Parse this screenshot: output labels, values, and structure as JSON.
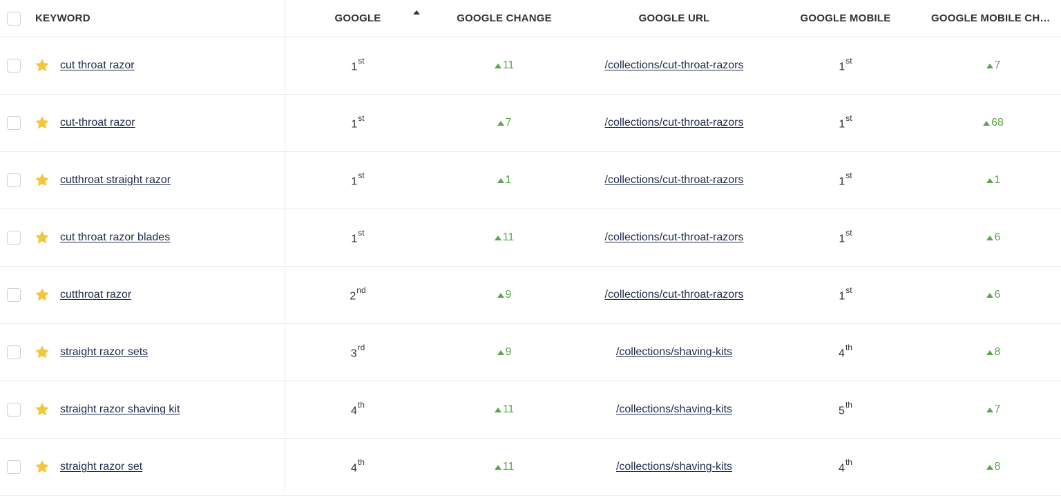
{
  "header": {
    "keyword": "KEYWORD",
    "google": "GOOGLE",
    "google_change": "GOOGLE CHANGE",
    "google_url": "GOOGLE URL",
    "google_mobile": "GOOGLE MOBILE",
    "google_mobile_change": "GOOGLE MOBILE CHANGE"
  },
  "sort": {
    "column": "google",
    "direction": "ascending",
    "icon": "sort-up-icon"
  },
  "colors": {
    "star": "#f5c53b",
    "change_up": "#5aa64a",
    "link": "#1e2a4a"
  },
  "rows": [
    {
      "keyword": "cut throat razor",
      "google_rank": "1",
      "google_rank_suffix": "st",
      "google_change": "11",
      "google_url": "/collections/cut-throat-razors",
      "mobile_rank": "1",
      "mobile_rank_suffix": "st",
      "mobile_change": "7"
    },
    {
      "keyword": "cut-throat razor",
      "google_rank": "1",
      "google_rank_suffix": "st",
      "google_change": "7",
      "google_url": "/collections/cut-throat-razors",
      "mobile_rank": "1",
      "mobile_rank_suffix": "st",
      "mobile_change": "68"
    },
    {
      "keyword": "cutthroat straight razor",
      "google_rank": "1",
      "google_rank_suffix": "st",
      "google_change": "1",
      "google_url": "/collections/cut-throat-razors",
      "mobile_rank": "1",
      "mobile_rank_suffix": "st",
      "mobile_change": "1"
    },
    {
      "keyword": "cut throat razor blades",
      "google_rank": "1",
      "google_rank_suffix": "st",
      "google_change": "11",
      "google_url": "/collections/cut-throat-razors",
      "mobile_rank": "1",
      "mobile_rank_suffix": "st",
      "mobile_change": "6"
    },
    {
      "keyword": "cutthroat razor",
      "google_rank": "2",
      "google_rank_suffix": "nd",
      "google_change": "9",
      "google_url": "/collections/cut-throat-razors",
      "mobile_rank": "1",
      "mobile_rank_suffix": "st",
      "mobile_change": "6"
    },
    {
      "keyword": "straight razor sets",
      "google_rank": "3",
      "google_rank_suffix": "rd",
      "google_change": "9",
      "google_url": "/collections/shaving-kits",
      "mobile_rank": "4",
      "mobile_rank_suffix": "th",
      "mobile_change": "8"
    },
    {
      "keyword": "straight razor shaving kit",
      "google_rank": "4",
      "google_rank_suffix": "th",
      "google_change": "11",
      "google_url": "/collections/shaving-kits",
      "mobile_rank": "5",
      "mobile_rank_suffix": "th",
      "mobile_change": "7"
    },
    {
      "keyword": "straight razor set",
      "google_rank": "4",
      "google_rank_suffix": "th",
      "google_change": "11",
      "google_url": "/collections/shaving-kits",
      "mobile_rank": "4",
      "mobile_rank_suffix": "th",
      "mobile_change": "8"
    }
  ]
}
